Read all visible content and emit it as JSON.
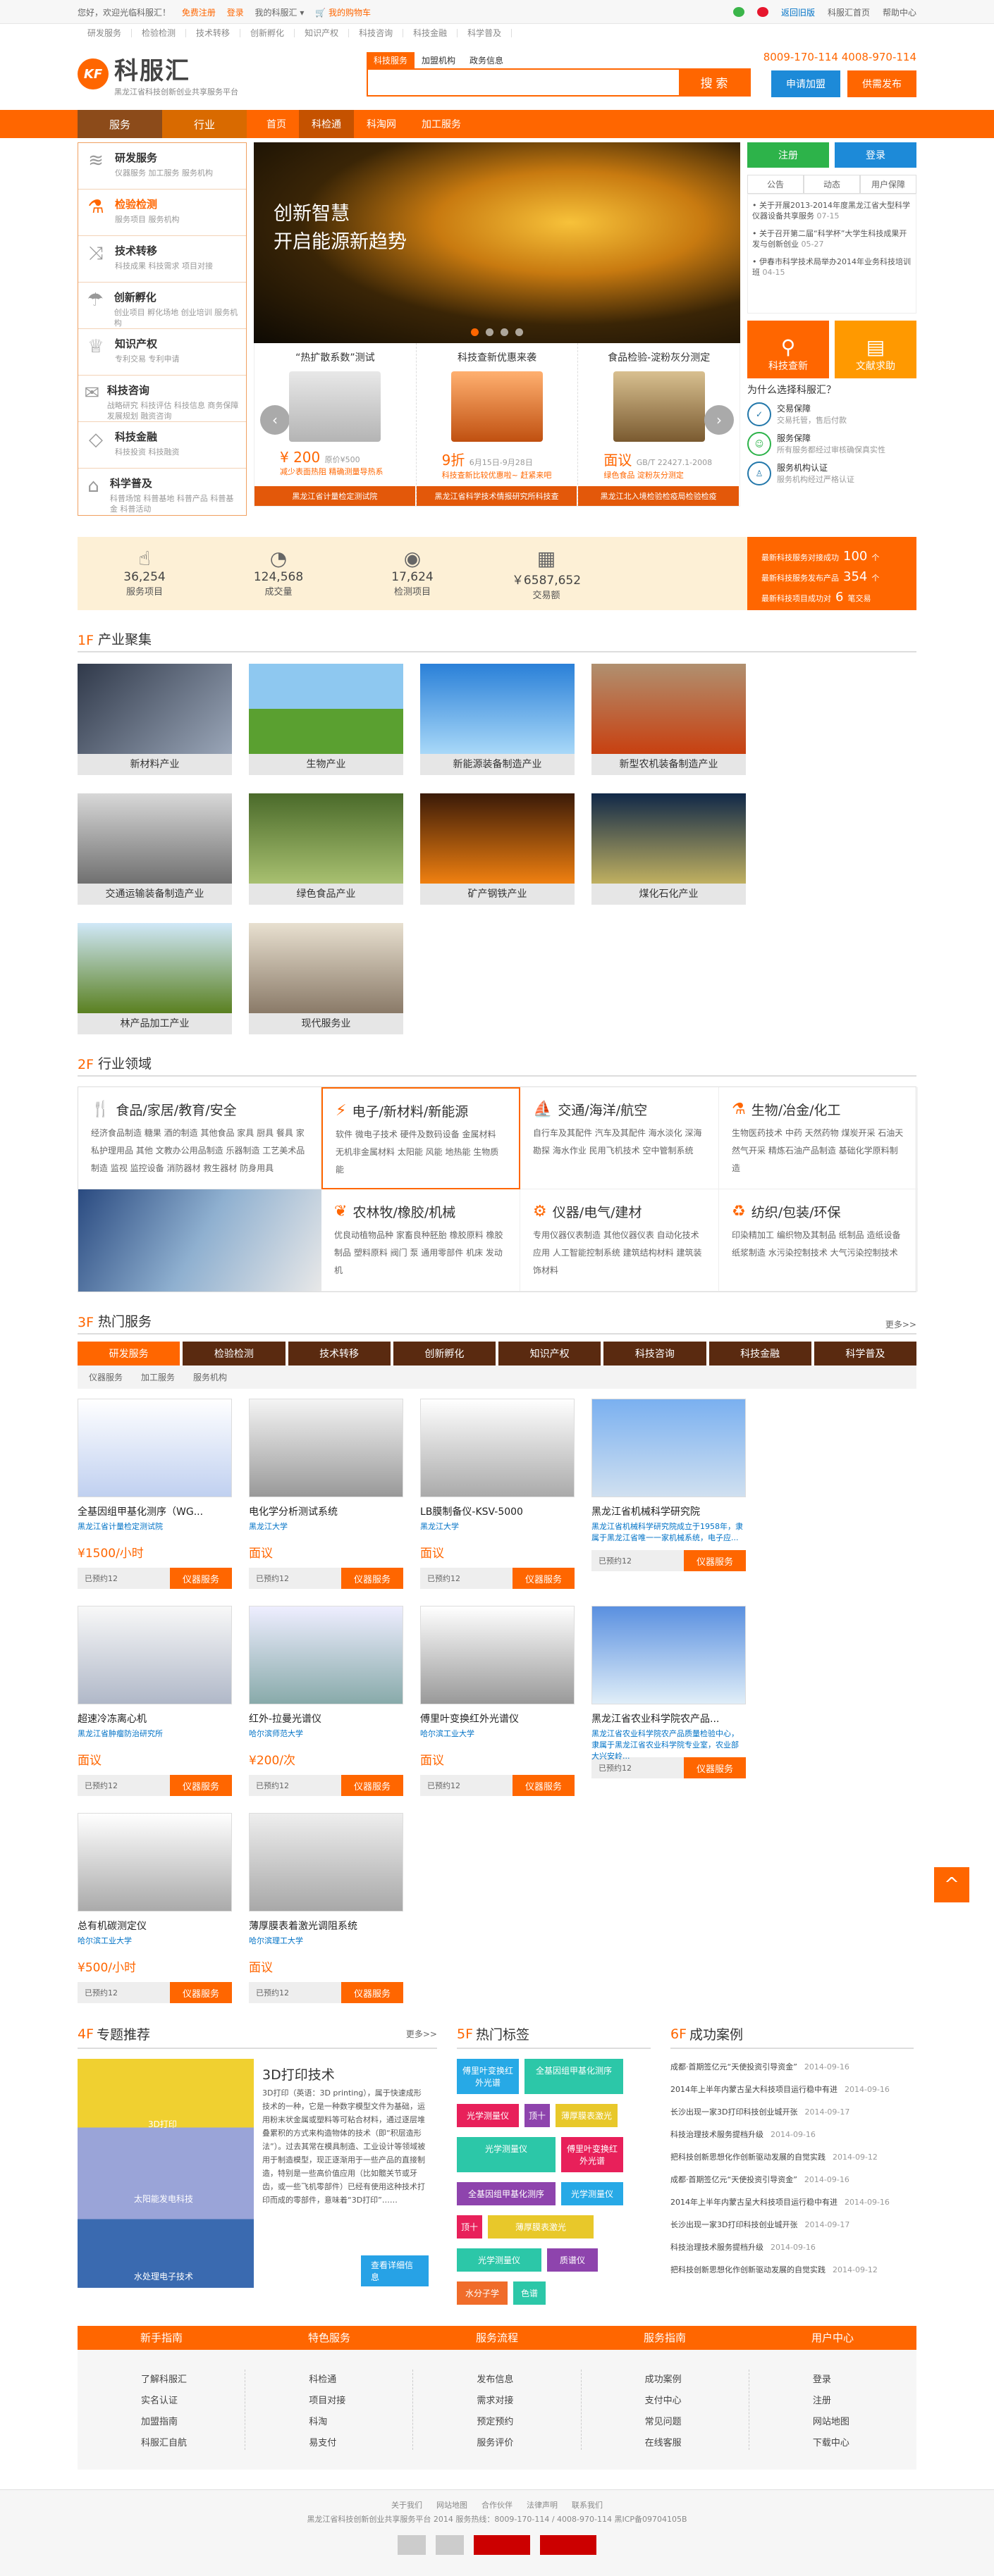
{
  "topbar": {
    "welcome": "您好，欢迎光临科服汇！",
    "register": "免费注册",
    "login": "登录",
    "my": "我的科服汇 ▾",
    "cart": "我的购物车",
    "old": "返回旧版",
    "home": "科服汇首页",
    "help": "帮助中心"
  },
  "subnav": [
    "研发服务",
    "检验检测",
    "技术转移",
    "创新孵化",
    "知识产权",
    "科技咨询",
    "科技金融",
    "科学普及"
  ],
  "logo": {
    "mark": "KF",
    "name": "科服汇",
    "slogan": "黑龙江省科技创新创业共享服务平台"
  },
  "search": {
    "tabs": [
      "科技服务",
      "加盟机构",
      "政务信息"
    ],
    "placeholder": "",
    "button": "搜 索"
  },
  "phones": "8009-170-114   4008-970-114",
  "hbtns": [
    "申请加盟",
    "供需发布"
  ],
  "nav": {
    "side": [
      "服务",
      "行业"
    ],
    "items": [
      "首页",
      "科检通",
      "科淘网",
      "加工服务"
    ]
  },
  "cats": [
    {
      "title": "研发服务",
      "sub": "仪器服务 加工服务 服务机构"
    },
    {
      "title": "检验检测",
      "sub": "服务项目 服务机构"
    },
    {
      "title": "技术转移",
      "sub": "科技成果 科技需求 项目对接"
    },
    {
      "title": "创新孵化",
      "sub": "创业项目 孵化场地 创业培训 服务机构"
    },
    {
      "title": "知识产权",
      "sub": "专利交易 专利申请"
    },
    {
      "title": "科技咨询",
      "sub": "战略研究 科技评估 科技信息 商务保障 发展规划 融资咨询"
    },
    {
      "title": "科技金融",
      "sub": "科技投资 科技融资"
    },
    {
      "title": "科学普及",
      "sub": "科普场馆 科普基地 科普产品 科普基金 科普活动"
    }
  ],
  "banner": {
    "line1": "创新智慧",
    "line2": "开启能源新趋势"
  },
  "products": [
    {
      "title": "“热扩散系数”测试",
      "price": "¥ 200",
      "orig": "原价¥500",
      "desc": "减少表面热阻 精确测量导热系",
      "bar": "黑龙江省计量检定测试院"
    },
    {
      "title": "科技查新优惠来袭",
      "price": "9折",
      "orig": "6月15日-9月28日",
      "desc": "科技查新比较优惠啦~ 赶紧来吧",
      "bar": "黑龙江省科学技术情报研究所科技查"
    },
    {
      "title": "食品检验-淀粉灰分测定",
      "price": "面议",
      "orig": "GB/T 22427.1-2008",
      "desc": "绿色食品 淀粉灰分测定",
      "bar": "黑龙江北入境检验检疫局检验检疫"
    }
  ],
  "right": {
    "reg": "注册",
    "login": "登录",
    "tabs": [
      "公告",
      "动态",
      "用户保障"
    ],
    "news": [
      {
        "t": "关于开展2013-2014年度黑龙江省大型科学仪器设备共享服务",
        "d": "07-15"
      },
      {
        "t": "关于召开第二届“科学杯”大学生科技成果开发与创新创业",
        "d": "05-27"
      },
      {
        "t": "伊春市科学技术局举办2014年业务科技培训班",
        "d": "04-15"
      }
    ],
    "quick": [
      "科技查新",
      "文献求助"
    ],
    "why": "为什么选择科服汇？",
    "reasons": [
      {
        "t": "交易保障",
        "s": "交易托管，售后付款"
      },
      {
        "t": "服务保障",
        "s": "所有服务都经过审核确保真实性"
      },
      {
        "t": "服务机构认证",
        "s": "服务机构经过严格认证"
      }
    ]
  },
  "stats": [
    {
      "v": "36,254",
      "l": "服务项目"
    },
    {
      "v": "124,568",
      "l": "成交量"
    },
    {
      "v": "17,624",
      "l": "检测项目"
    },
    {
      "v": "￥6587,652",
      "l": "交易额"
    }
  ],
  "latest": [
    {
      "l": "最新科技服务对接成功",
      "n": "100",
      "u": "个"
    },
    {
      "l": "最新科技服务发布产品",
      "n": "354",
      "u": "个"
    },
    {
      "l": "最新科技项目成功对",
      "n": "6",
      "u": "笔交易"
    }
  ],
  "s1": {
    "n": "1F",
    "t": "产业聚集"
  },
  "industries": [
    "新材料产业",
    "生物产业",
    "新能源装备制造产业",
    "新型农机装备制造产业",
    "交通运输装备制造产业",
    "绿色食品产业",
    "矿产钢铁产业",
    "煤化石化产业",
    "林产品加工产业",
    "现代服务业"
  ],
  "s2": {
    "n": "2F",
    "t": "行业领域"
  },
  "fields": [
    {
      "h": "食品/家居/教育/安全",
      "l": "经济食品制造  糖果  酒的制造  其他食品  家具  厨具  餐具  家私护理用品  其他  文教办公用品制造  乐器制造  工艺美术品制造  监视  监控设备  消防器材  救生器材  防身用具"
    },
    {
      "h": "电子/新材料/新能源",
      "l": "软件  微电子技术  硬件及数码设备  金属材料  无机非金属材料  太阳能  风能  地热能  生物质能"
    },
    {
      "h": "交通/海洋/航空",
      "l": "自行车及其配件  汽车及其配件  海水淡化  深海勘探  海水作业  民用飞机技术  空中管制系统"
    },
    {
      "h": "生物/冶金/化工",
      "l": "生物医药技术  中药  天然药物  煤炭开采  石油天然气开采  精炼石油产品制造  基础化学原料制造"
    },
    {
      "h": "农林牧/橡胶/机械",
      "l": "优良动植物品种  家畜良种胚胎  橡胶原料  橡胶制品  塑料原料  阀门  泵  通用零部件  机床  发动机"
    },
    {
      "h": "仪器/电气/建材",
      "l": "专用仪器仪表制造  其他仪器仪表  自动化技术应用  人工智能控制系统  建筑结构材料  建筑装饰材料"
    },
    {
      "h": "纺织/包装/环保",
      "l": "印染精加工  编织物及其制品  纸制品  造纸设备  纸浆制造  水污染控制技术  大气污染控制技术"
    }
  ],
  "s3": {
    "n": "3F",
    "t": "热门服务",
    "more": "更多>>"
  },
  "hotTabs": [
    "研发服务",
    "检验检测",
    "技术转移",
    "创新孵化",
    "知识产权",
    "科技咨询",
    "科技金融",
    "科学普及"
  ],
  "hotSub": [
    "仪器服务",
    "加工服务",
    "服务机构"
  ],
  "goods": [
    {
      "t": "全基因组甲基化测序（WG...",
      "s": "黑龙江省计量检定测试院",
      "p": "¥1500/小时"
    },
    {
      "t": "电化学分析测试系统",
      "s": "黑龙江大学",
      "p": "面议"
    },
    {
      "t": "LB膜制备仪-KSV-5000",
      "s": "黑龙江大学",
      "p": "面议"
    },
    {
      "t": "黑龙江省机械科学研究院",
      "s": "黑龙江省机械科学研究院成立于1958年，隶属于黑龙江省唯一一家机械系统，电子应...",
      "p": ""
    },
    {
      "t": "超速冷冻离心机",
      "s": "黑龙江省肿瘤防治研究所",
      "p": "面议"
    },
    {
      "t": "红外-拉曼光谱仪",
      "s": "哈尔滨师范大学",
      "p": "¥200/次"
    },
    {
      "t": "傅里叶变换红外光谱仪",
      "s": "哈尔滨工业大学",
      "p": "面议"
    },
    {
      "t": "黑龙江省农业科学院农产品...",
      "s": "黑龙江省农业科学院农产品质量检验中心，隶属于黑龙江省农业科学院专业室，农业部大兴安岭...",
      "p": ""
    },
    {
      "t": "总有机碳测定仪",
      "s": "哈尔滨工业大学",
      "p": "¥500/小时"
    },
    {
      "t": "薄厚膜表着激光调阻系统",
      "s": "哈尔滨理工大学",
      "p": "面议"
    }
  ],
  "sold": "已预约12",
  "gbtn": "仪器服务",
  "s4": {
    "n": "4F",
    "t": "专题推荐",
    "more": "更多>>"
  },
  "topic": {
    "title": "3D打印技术",
    "body": "3D打印（英语：3D printing），属于快速成形技术的一种，它是一种数字模型文件为基础，运用粉末状金属或塑料等可粘合材料，通过逐层堆叠累积的方式来构造物体的技术（即“积层造形法”）。过去其常在模具制造、工业设计等领域被用于制造模型，现正逐渐用于一些产品的直接制造，特别是一些高价值应用（比如髋关节或牙齿，或一些飞机零部件）已经有使用这种技术打印而成的零部件，意味着“3D打印”……",
    "det": "查看详细信息",
    "img": [
      "3D打印",
      "太阳能发电科技",
      "水处理电子技术"
    ]
  },
  "s5": {
    "n": "5F",
    "t": "热门标签"
  },
  "tags": [
    {
      "t": "傅里叶变换红外光谱",
      "c": "#27a9e6"
    },
    {
      "t": "全基因组甲基化测序",
      "c": "#2cc7a8"
    },
    {
      "t": "光学测量仪",
      "c": "#e8205a"
    },
    {
      "t": "顶十",
      "c": "#8e44ad"
    },
    {
      "t": "薄厚膜表激光",
      "c": "#e8c82a"
    },
    {
      "t": "光学测量仪",
      "c": "#2cc7a8"
    },
    {
      "t": "傅里叶变换红外光谱",
      "c": "#e8205a"
    },
    {
      "t": "全基因组甲基化测序",
      "c": "#8e44ad"
    },
    {
      "t": "光学测量仪",
      "c": "#27a9e6"
    },
    {
      "t": "顶十",
      "c": "#e8205a"
    },
    {
      "t": "薄厚膜表激光",
      "c": "#e8c82a"
    },
    {
      "t": "光学测量仪",
      "c": "#2cc7a8"
    },
    {
      "t": "质谱仪",
      "c": "#8e44ad"
    },
    {
      "t": "水分子学",
      "c": "#f06c2a"
    },
    {
      "t": "色谱",
      "c": "#2cc7a8"
    }
  ],
  "s6": {
    "n": "6F",
    "t": "成功案例"
  },
  "cases": [
    {
      "t": "成都·首期签亿元“天使投资引导资金”",
      "d": "2014-09-16"
    },
    {
      "t": "2014年上半年内蒙古呈大科技项目运行稳中有进",
      "d": "2014-09-16"
    },
    {
      "t": "长沙出现一家3D打印科技创业城开张",
      "d": "2014-09-17"
    },
    {
      "t": "科技治理技术服务提档升级",
      "d": "2014-09-16"
    },
    {
      "t": "把科技创新思想化作创新驱动发展的自觉实践",
      "d": "2014-09-12"
    },
    {
      "t": "成都·首期签亿元“天使投资引导资金”",
      "d": "2014-09-16"
    },
    {
      "t": "2014年上半年内蒙古呈大科技项目运行稳中有进",
      "d": "2014-09-16"
    },
    {
      "t": "长沙出现一家3D打印科技创业城开张",
      "d": "2014-09-17"
    },
    {
      "t": "科技治理技术服务提档升级",
      "d": "2014-09-16"
    },
    {
      "t": "把科技创新思想化作创新驱动发展的自觉实践",
      "d": "2014-09-12"
    }
  ],
  "guide": [
    {
      "h": "新手指南",
      "l": [
        "了解科服汇",
        "实名认证",
        "加盟指南",
        "科服汇自航"
      ]
    },
    {
      "h": "特色服务",
      "l": [
        "科检通",
        "项目对接",
        "科淘",
        "易支付"
      ]
    },
    {
      "h": "服务流程",
      "l": [
        "发布信息",
        "需求对接",
        "预定预约",
        "服务评价"
      ]
    },
    {
      "h": "服务指南",
      "l": [
        "成功案例",
        "支付中心",
        "常见问题",
        "在线客服"
      ]
    },
    {
      "h": "用户中心",
      "l": [
        "登录",
        "注册",
        "网站地图",
        "下载中心"
      ]
    }
  ],
  "footer": {
    "links": [
      "关于我们",
      "网站地图",
      "合作伙伴",
      "法律声明",
      "联系我们"
    ],
    "copy": "黑龙江省科技创新创业共享服务平台 2014   服务热线：8009-170-114 / 4008-970-114   黑ICP备09704105B"
  },
  "totop": "^"
}
